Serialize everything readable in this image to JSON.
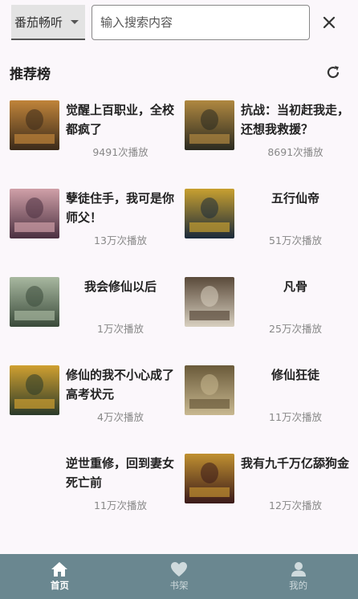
{
  "search": {
    "source_selected": "番茄畅听",
    "placeholder": "输入搜索内容",
    "clear_icon": "close-icon"
  },
  "section": {
    "title": "推荐榜",
    "refresh_icon": "refresh-icon"
  },
  "books": [
    {
      "title": "觉醒上百职业，全校都疯了",
      "plays": "9491次播放",
      "cover_colors": [
        "#3a2a1a",
        "#c0843a"
      ]
    },
    {
      "title": "抗战：当初赶我走，还想我救援？",
      "plays": "8691次播放",
      "cover_colors": [
        "#2a2a20",
        "#b08840"
      ]
    },
    {
      "title": "孽徒住手，我可是你师父！",
      "plays": "13万次播放",
      "cover_colors": [
        "#4a3040",
        "#d0a0a8"
      ]
    },
    {
      "title": "五行仙帝",
      "plays": "51万次播放",
      "cover_colors": [
        "#1a2a3a",
        "#c8a030"
      ]
    },
    {
      "title": "我会修仙以后",
      "plays": "1万次播放",
      "cover_colors": [
        "#3a4a3a",
        "#a8b8a0"
      ]
    },
    {
      "title": "凡骨",
      "plays": "25万次播放",
      "cover_colors": [
        "#d8d0c0",
        "#5a4a3a"
      ]
    },
    {
      "title": "修仙的我不小心成了高考状元",
      "plays": "4万次播放",
      "cover_colors": [
        "#2a3a2a",
        "#d0a030"
      ]
    },
    {
      "title": "修仙狂徒",
      "plays": "11万次播放",
      "cover_colors": [
        "#c8b890",
        "#6a5a3a"
      ]
    },
    {
      "title": "逆世重修，回到妻女死亡前",
      "plays": "11万次播放",
      "cover_colors": [
        "#fbf7fb",
        "#fbf7fb"
      ]
    },
    {
      "title": "我有九千万亿舔狗金",
      "plays": "12万次播放",
      "cover_colors": [
        "#3a1a1a",
        "#c09030"
      ]
    }
  ],
  "nav": [
    {
      "label": "首页",
      "icon": "home-icon",
      "active": true
    },
    {
      "label": "书架",
      "icon": "heart-icon",
      "active": false
    },
    {
      "label": "我的",
      "icon": "person-icon",
      "active": false
    }
  ]
}
